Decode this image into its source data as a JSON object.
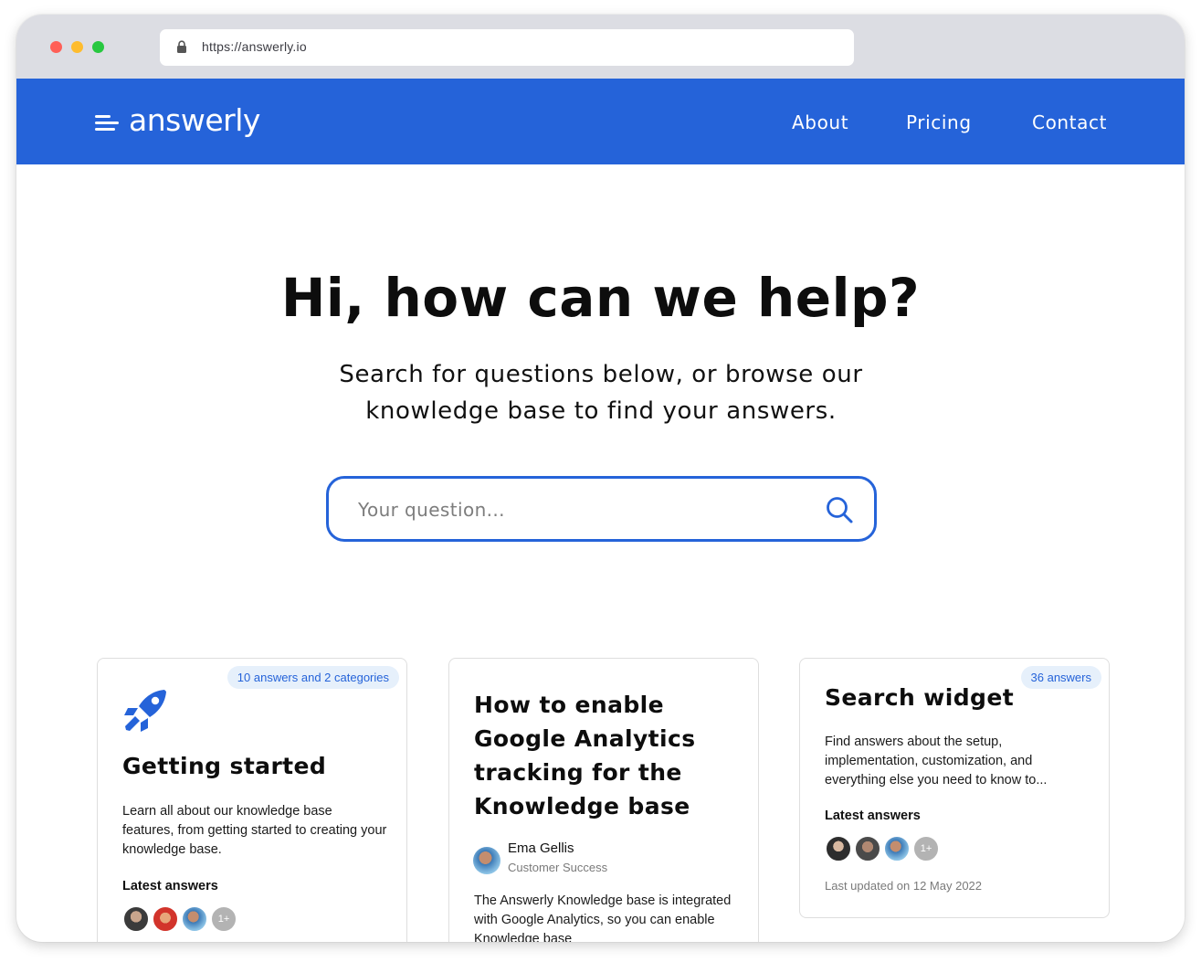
{
  "browser": {
    "url": "https://answerly.io"
  },
  "nav": {
    "logo": "answerly",
    "links": [
      "About",
      "Pricing",
      "Contact"
    ]
  },
  "hero": {
    "title": "Hi, how can we help?",
    "subtitle": "Search for questions below, or browse our knowledge base to find your answers.",
    "search_placeholder": "Your question..."
  },
  "colors": {
    "brand": "#2563d9",
    "badge_bg": "#e6f0fb"
  },
  "cards": [
    {
      "icon": "rocket-icon",
      "badge": "10 answers and 2 categories",
      "title": "Getting started",
      "description": "Learn all about our knowledge base features, from getting started to creating your knowledge base.",
      "latest_label": "Latest answers",
      "more_label": "1+"
    },
    {
      "title": "How to enable Google Analytics tracking for the Knowledge base",
      "author_name": "Ema Gellis",
      "author_role": "Customer Success",
      "description": "The Answerly Knowledge base is integrated with Google Analytics, so you can enable Knowledge base"
    },
    {
      "badge": "36 answers",
      "title": "Search widget",
      "description": "Find answers about the setup, implementation, customization, and everything else you need to know to...",
      "latest_label": "Latest answers",
      "more_label": "1+",
      "updated": "Last updated on 12 May 2022"
    }
  ]
}
